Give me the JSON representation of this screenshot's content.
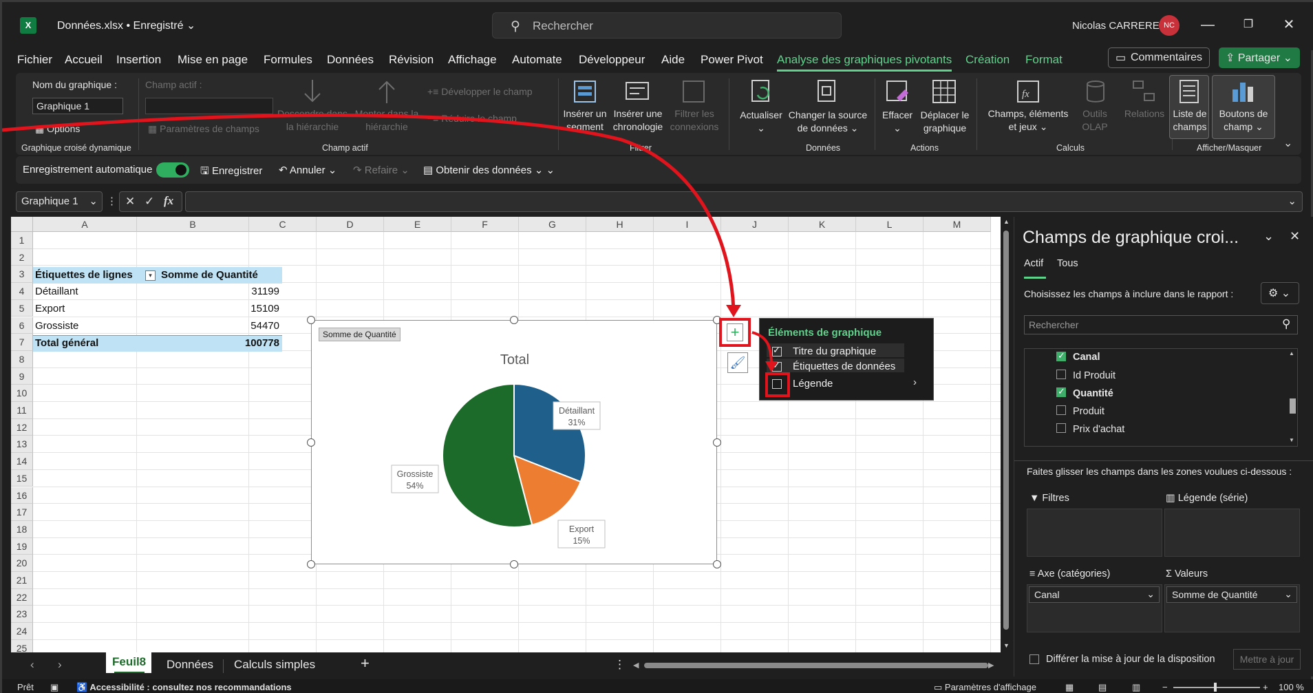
{
  "window": {
    "title": "Données.xlsx • Enregistré",
    "search_placeholder": "Rechercher",
    "user_name": "Nicolas CARRERE",
    "user_initials": "NC"
  },
  "menu": {
    "tabs": [
      "Fichier",
      "Accueil",
      "Insertion",
      "Mise en page",
      "Formules",
      "Données",
      "Révision",
      "Affichage",
      "Automate",
      "Développeur",
      "Aide",
      "Power Pivot",
      "Analyse des graphiques pivotants",
      "Création",
      "Format"
    ],
    "active_tab": "Analyse des graphiques pivotants",
    "comments": "Commentaires",
    "share": "Partager"
  },
  "ribbon": {
    "chart_name_label": "Nom du graphique :",
    "chart_name_value": "Graphique 1",
    "options": "Options",
    "group_chart": "Graphique croisé dynamique",
    "active_field_label": "Champ actif :",
    "field_settings": "Paramètres de champs",
    "drill_down": "Descendre dans la hiérarchie",
    "drill_up": "Monter dans la hiérarchie",
    "expand_field": "Développer le champ",
    "collapse_field": "Réduire le champ",
    "group_active_field": "Champ actif",
    "insert_slicer": "Insérer un segment",
    "insert_timeline": "Insérer une chronologie",
    "filter_connections": "Filtrer les connexions",
    "group_filter": "Filtrer",
    "refresh": "Actualiser",
    "change_source": "Changer la source de données",
    "group_data": "Données",
    "clear": "Effacer",
    "move_chart": "Déplacer le graphique",
    "group_actions": "Actions",
    "fields_items_sets": "Champs, éléments et jeux",
    "olap_tools": "Outils OLAP",
    "relations": "Relations",
    "group_calculations": "Calculs",
    "field_list": "Liste de champs",
    "field_buttons": "Boutons de champ",
    "group_show_hide": "Afficher/Masquer"
  },
  "qat": {
    "autosave": "Enregistrement automatique",
    "save": "Enregistrer",
    "undo": "Annuler",
    "redo": "Refaire",
    "get_data": "Obtenir des données"
  },
  "formula_bar": {
    "name_box": "Graphique 1",
    "fx": "fx"
  },
  "sheet": {
    "columns": [
      "A",
      "B",
      "C",
      "D",
      "E",
      "F",
      "G",
      "H",
      "I",
      "J",
      "K",
      "L",
      "M"
    ],
    "rows": [
      "1",
      "2",
      "3",
      "4",
      "5",
      "6",
      "7",
      "8",
      "9",
      "10",
      "11",
      "12",
      "13",
      "14",
      "15",
      "16",
      "17",
      "18",
      "19",
      "20",
      "21",
      "22",
      "23",
      "24",
      "25"
    ],
    "pivot_header_labels": "Étiquettes de lignes",
    "pivot_header_sum": "Somme de Quantité",
    "pivot_rows": [
      {
        "label": "Détaillant",
        "value": "31199"
      },
      {
        "label": "Export",
        "value": "15109"
      },
      {
        "label": "Grossiste",
        "value": "54470"
      }
    ],
    "total_label": "Total général",
    "total_value": "100778"
  },
  "chart": {
    "field_button": "Somme de Quantité",
    "title": "Total"
  },
  "chart_data": {
    "type": "pie",
    "title": "Total",
    "categories": [
      "Détaillant",
      "Export",
      "Grossiste"
    ],
    "values": [
      31199,
      15109,
      54470
    ],
    "percent_labels": [
      "31%",
      "15%",
      "54%"
    ],
    "colors": [
      "#1f5f8b",
      "#ed7d31",
      "#1d6b2a"
    ]
  },
  "chart_elements_popup": {
    "heading": "Éléments de graphique",
    "items": [
      {
        "label": "Titre du graphique",
        "checked": true
      },
      {
        "label": "Étiquettes de données",
        "checked": true
      },
      {
        "label": "Légende",
        "checked": false
      }
    ]
  },
  "pane": {
    "title": "Champs de graphique croi...",
    "tab_active": "Actif",
    "tab_all": "Tous",
    "choose_fields": "Choisissez les champs à inclure dans le rapport :",
    "search_placeholder": "Rechercher",
    "fields": [
      {
        "label": "Canal",
        "checked": true
      },
      {
        "label": "Id Produit",
        "checked": false
      },
      {
        "label": "Quantité",
        "checked": true
      },
      {
        "label": "Produit",
        "checked": false
      },
      {
        "label": "Prix d'achat",
        "checked": false
      }
    ],
    "drag_hint": "Faites glisser les champs dans les zones voulues ci-dessous :",
    "zone_filters": "Filtres",
    "zone_legend": "Légende (série)",
    "zone_axis": "Axe (catégories)",
    "zone_values": "Valeurs",
    "axis_field": "Canal",
    "values_field": "Somme de Quantité",
    "defer_update": "Différer la mise à jour de la disposition",
    "update_button": "Mettre à jour"
  },
  "sheet_tabs": {
    "tabs": [
      "Feuil8",
      "Données",
      "Calculs simples"
    ],
    "active": "Feuil8"
  },
  "status": {
    "ready": "Prêt",
    "accessibility": "Accessibilité : consultez nos recommandations",
    "display_settings": "Paramètres d'affichage",
    "zoom": "100 %"
  },
  "colors": {
    "accent_green": "#5fd38b",
    "annotation_red": "#e0141c",
    "pivot_header_bg": "#bfe3f5"
  }
}
